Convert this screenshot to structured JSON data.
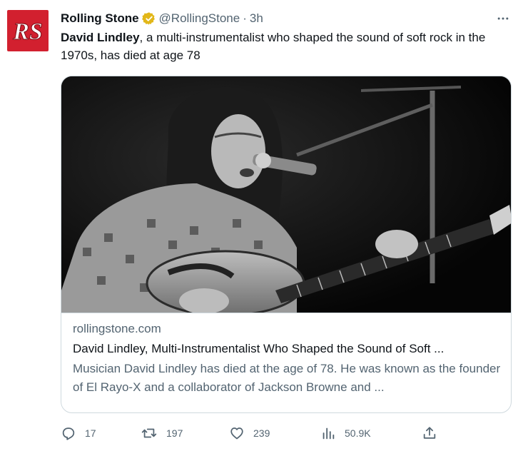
{
  "author": {
    "name": "Rolling Stone",
    "handle": "@RollingStone",
    "separator": "·",
    "time": "3h",
    "avatar_text": "RS",
    "verified_color": "#e2b719"
  },
  "tweet": {
    "bold_text": "David Lindley",
    "text": ", a multi-instrumentalist who shaped the sound of soft rock in the 1970s, has died at age 78"
  },
  "card": {
    "domain": "rollingstone.com",
    "title": "David Lindley, Multi-Instrumentalist Who Shaped the Sound of Soft ...",
    "description": "Musician David Lindley has died at the age of 78. He was known as the founder of El Rayo-X and a collaborator of Jackson Browne and ..."
  },
  "actions": {
    "replies": "17",
    "retweets": "197",
    "likes": "239",
    "views": "50.9K"
  },
  "icons": {
    "more": "more-icon",
    "reply": "reply-icon",
    "retweet": "retweet-icon",
    "like": "like-icon",
    "views": "views-icon",
    "share": "share-icon"
  },
  "colors": {
    "brand_red": "#d2202f",
    "muted": "#536471",
    "border": "#cfd9de"
  }
}
